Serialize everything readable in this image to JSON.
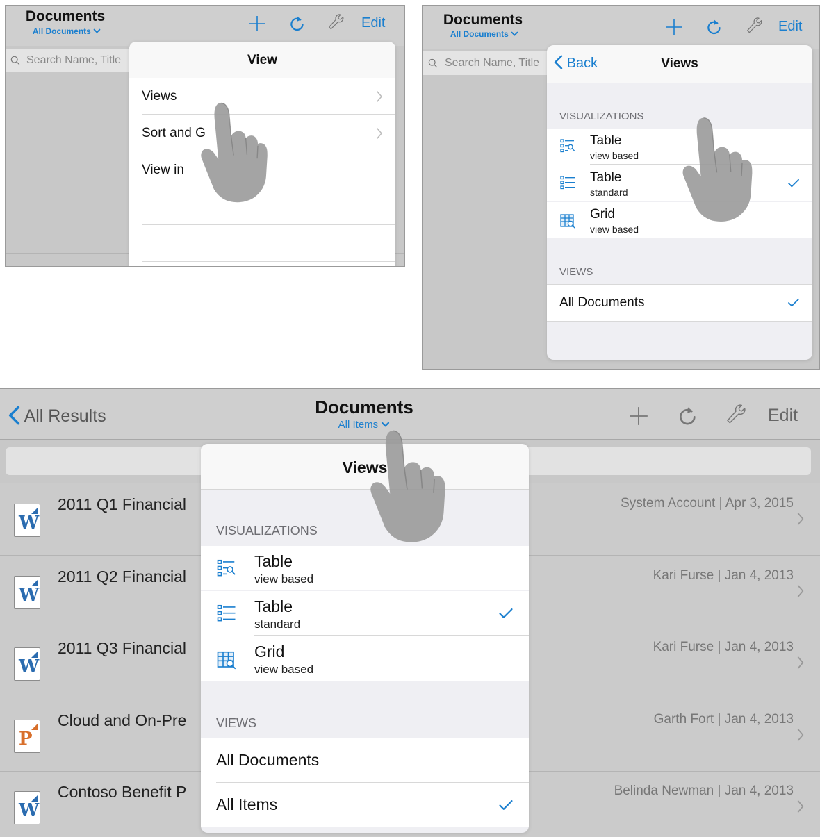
{
  "colors": {
    "accent": "#1a7fcf",
    "word": "#2b6cb0",
    "powerpoint": "#d86f2b"
  },
  "panel1": {
    "title": "Documents",
    "subtitle": "All Documents",
    "edit_label": "Edit",
    "search_placeholder": "Search Name, Title",
    "popover": {
      "title": "View",
      "items": [
        "Views",
        "Sort and G",
        "View in"
      ]
    }
  },
  "panel2": {
    "title": "Documents",
    "subtitle": "All Documents",
    "edit_label": "Edit",
    "search_placeholder": "Search Name, Title",
    "popover": {
      "back_label": "Back",
      "title": "Views",
      "visualizations_header": "VISUALIZATIONS",
      "visualizations": [
        {
          "name": "Table",
          "sub": "view based",
          "icon": "table-view-based-icon",
          "checked": false
        },
        {
          "name": "Table",
          "sub": "standard",
          "icon": "table-standard-icon",
          "checked": true
        },
        {
          "name": "Grid",
          "sub": "view based",
          "icon": "grid-view-based-icon",
          "checked": false
        }
      ],
      "views_header": "VIEWS",
      "views": [
        {
          "name": "All Documents",
          "checked": true
        }
      ]
    }
  },
  "panel3": {
    "back_label": "All Results",
    "title": "Documents",
    "subtitle": "All Items",
    "edit_label": "Edit",
    "documents": [
      {
        "name": "2011 Q1 Financial",
        "meta": "System Account | Apr 3, 2015",
        "type": "word",
        "letter": "W"
      },
      {
        "name": "2011 Q2 Financial",
        "meta": "Kari Furse | Jan 4, 2013",
        "type": "word",
        "letter": "W"
      },
      {
        "name": "2011 Q3 Financial",
        "meta": "Kari Furse | Jan 4, 2013",
        "type": "word",
        "letter": "W"
      },
      {
        "name": "Cloud and On-Pre",
        "meta": "Garth Fort | Jan 4, 2013",
        "type": "powerpoint",
        "letter": "P"
      },
      {
        "name": "Contoso Benefit P",
        "meta": "Belinda Newman | Jan 4, 2013",
        "type": "word",
        "letter": "W"
      }
    ],
    "popover": {
      "title": "Views",
      "visualizations_header": "VISUALIZATIONS",
      "visualizations": [
        {
          "name": "Table",
          "sub": "view based",
          "icon": "table-view-based-icon",
          "checked": false
        },
        {
          "name": "Table",
          "sub": "standard",
          "icon": "table-standard-icon",
          "checked": true
        },
        {
          "name": "Grid",
          "sub": "view based",
          "icon": "grid-view-based-icon",
          "checked": false
        }
      ],
      "views_header": "VIEWS",
      "views": [
        {
          "name": "All Documents",
          "checked": false
        },
        {
          "name": "All Items",
          "checked": true
        }
      ]
    }
  }
}
